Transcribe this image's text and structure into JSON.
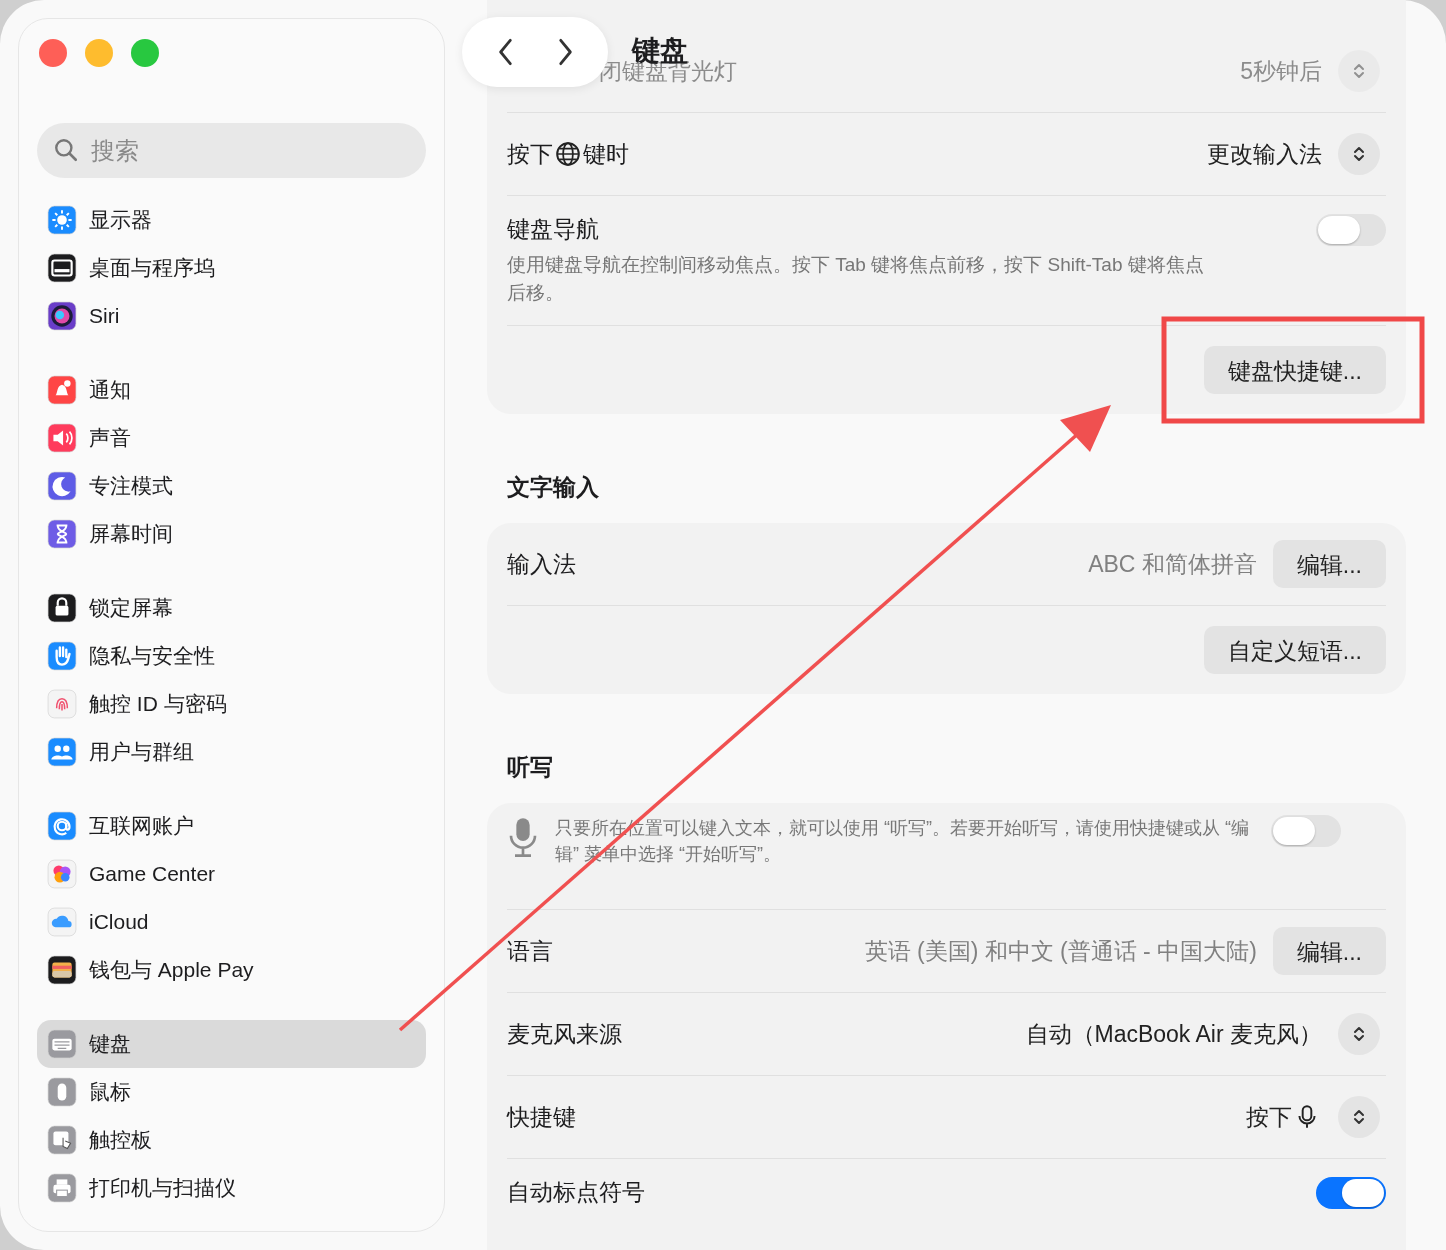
{
  "window": {
    "title": "键盘",
    "controls": [
      {
        "color": "#fe5f57"
      },
      {
        "color": "#febc2e"
      },
      {
        "color": "#28c840"
      }
    ]
  },
  "search": {
    "placeholder": "搜索"
  },
  "sidebar": {
    "groups": [
      [
        {
          "label": "显示器",
          "kind": "sun",
          "color": "#1a8cff",
          "selected": false
        },
        {
          "label": "桌面与程序坞",
          "kind": "dock",
          "color": "#1c1c1e",
          "selected": false
        },
        {
          "label": "Siri",
          "kind": "orb",
          "color": "#6a3dc8",
          "selected": false
        }
      ],
      [
        {
          "label": "通知",
          "kind": "bell",
          "color": "#ff4545",
          "selected": false
        },
        {
          "label": "声音",
          "kind": "speaker",
          "color": "#ff3b5c",
          "selected": false
        },
        {
          "label": "专注模式",
          "kind": "moon",
          "color": "#5e5ce6",
          "selected": false
        },
        {
          "label": "屏幕时间",
          "kind": "hourglass",
          "color": "#6e5ce6",
          "selected": false
        }
      ],
      [
        {
          "label": "锁定屏幕",
          "kind": "lock",
          "color": "#1c1c1e",
          "selected": false
        },
        {
          "label": "隐私与安全性",
          "kind": "hand",
          "color": "#1a8cff",
          "selected": false
        },
        {
          "label": "触控 ID 与密码",
          "kind": "fingerprint",
          "color": "#f4f4f4",
          "selected": false
        },
        {
          "label": "用户与群组",
          "kind": "users",
          "color": "#1a8cff",
          "selected": false
        }
      ],
      [
        {
          "label": "互联网账户",
          "kind": "at",
          "color": "#1a8cff",
          "selected": false
        },
        {
          "label": "Game Center",
          "kind": "bubbles",
          "color": "#f4f4f4",
          "selected": false
        },
        {
          "label": "iCloud",
          "kind": "cloud",
          "color": "#f4f4f4",
          "selected": false
        },
        {
          "label": "钱包与 Apple Pay",
          "kind": "wallet",
          "color": "#1c1c1e",
          "selected": false
        }
      ],
      [
        {
          "label": "键盘",
          "kind": "keyboard",
          "color": "#9a9a9f",
          "selected": true
        },
        {
          "label": "鼠标",
          "kind": "mouse",
          "color": "#9a9a9f",
          "selected": false
        },
        {
          "label": "触控板",
          "kind": "trackpad",
          "color": "#9a9a9f",
          "selected": false
        },
        {
          "label": "打印机与扫描仪",
          "kind": "printer",
          "color": "#9a9a9f",
          "selected": false
        }
      ]
    ]
  },
  "sections": [
    {
      "rows": [
        {
          "kind": "popup-faded",
          "label": "闭键盘背光灯",
          "value": "5秒钟后"
        },
        {
          "kind": "popup-key",
          "label_parts": [
            "按下",
            "键时"
          ],
          "value": "更改输入法"
        },
        {
          "kind": "toggle",
          "label": "键盘导航",
          "description": "使用键盘导航在控制间移动焦点。按下 Tab 键将焦点前移，按下 Shift-Tab 键将焦点后移。",
          "on": false
        },
        {
          "kind": "button",
          "button": "键盘快捷键..."
        }
      ]
    },
    {
      "heading": "文字输入",
      "rows": [
        {
          "kind": "value-button",
          "label": "输入法",
          "value": "ABC 和简体拼音",
          "button": "编辑..."
        },
        {
          "kind": "button",
          "button": "自定义短语..."
        }
      ]
    },
    {
      "heading": "听写",
      "rows": [
        {
          "kind": "mic-toggle",
          "description": "只要所在位置可以键入文本，就可以使用 “听写”。若要开始听写，请使用快捷键或从 “编辑” 菜单中选择 “开始听写”。",
          "on": false
        },
        {
          "kind": "value-button",
          "label": "语言",
          "value": "英语 (美国) 和中文 (普通话 - 中国大陆)",
          "button": "编辑..."
        },
        {
          "kind": "popup",
          "label": "麦克风来源",
          "value": "自动（MacBook Air 麦克风）"
        },
        {
          "kind": "popup-mic",
          "label": "快捷键",
          "value": "按下"
        },
        {
          "kind": "toggle",
          "label": "自动标点符号",
          "on": true
        }
      ]
    }
  ]
}
